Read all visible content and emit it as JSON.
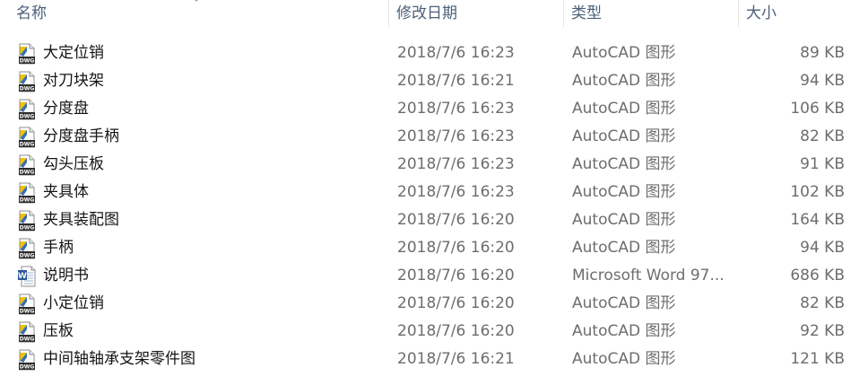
{
  "columns": {
    "name": "名称",
    "date": "修改日期",
    "type": "类型",
    "size": "大小"
  },
  "icons": {
    "dwg": "autocad-dwg-file-icon",
    "doc": "word-document-file-icon",
    "sort": "sort-indicator-icon"
  },
  "colors": {
    "dwg_yellow": "#f2c200",
    "dwg_band": "#2d2d2d",
    "doc_blue": "#2b5797",
    "header_text": "#4c607a",
    "meta_text": "#6d6d6d"
  },
  "files": [
    {
      "name": "大定位销",
      "date": "2018/7/6 16:23",
      "type": "AutoCAD 图形",
      "size": "89 KB",
      "icon": "dwg",
      "icon_text": "DWG"
    },
    {
      "name": "对刀块架",
      "date": "2018/7/6 16:21",
      "type": "AutoCAD 图形",
      "size": "94 KB",
      "icon": "dwg",
      "icon_text": "DWG"
    },
    {
      "name": "分度盘",
      "date": "2018/7/6 16:23",
      "type": "AutoCAD 图形",
      "size": "106 KB",
      "icon": "dwg",
      "icon_text": "DWG"
    },
    {
      "name": "分度盘手柄",
      "date": "2018/7/6 16:23",
      "type": "AutoCAD 图形",
      "size": "82 KB",
      "icon": "dwg",
      "icon_text": "DWG"
    },
    {
      "name": "勾头压板",
      "date": "2018/7/6 16:23",
      "type": "AutoCAD 图形",
      "size": "91 KB",
      "icon": "dwg",
      "icon_text": "DWG"
    },
    {
      "name": "夹具体",
      "date": "2018/7/6 16:23",
      "type": "AutoCAD 图形",
      "size": "102 KB",
      "icon": "dwg",
      "icon_text": "DWG"
    },
    {
      "name": "夹具装配图",
      "date": "2018/7/6 16:20",
      "type": "AutoCAD 图形",
      "size": "164 KB",
      "icon": "dwg",
      "icon_text": "DWG"
    },
    {
      "name": "手柄",
      "date": "2018/7/6 16:20",
      "type": "AutoCAD 图形",
      "size": "94 KB",
      "icon": "dwg",
      "icon_text": "DWG"
    },
    {
      "name": "说明书",
      "date": "2018/7/6 16:20",
      "type": "Microsoft Word 97...",
      "size": "686 KB",
      "icon": "doc",
      "icon_text": "W"
    },
    {
      "name": "小定位销",
      "date": "2018/7/6 16:20",
      "type": "AutoCAD 图形",
      "size": "82 KB",
      "icon": "dwg",
      "icon_text": "DWG"
    },
    {
      "name": "压板",
      "date": "2018/7/6 16:20",
      "type": "AutoCAD 图形",
      "size": "92 KB",
      "icon": "dwg",
      "icon_text": "DWG"
    },
    {
      "name": "中间轴轴承支架零件图",
      "date": "2018/7/6 16:21",
      "type": "AutoCAD 图形",
      "size": "121 KB",
      "icon": "dwg",
      "icon_text": "DWG"
    }
  ]
}
